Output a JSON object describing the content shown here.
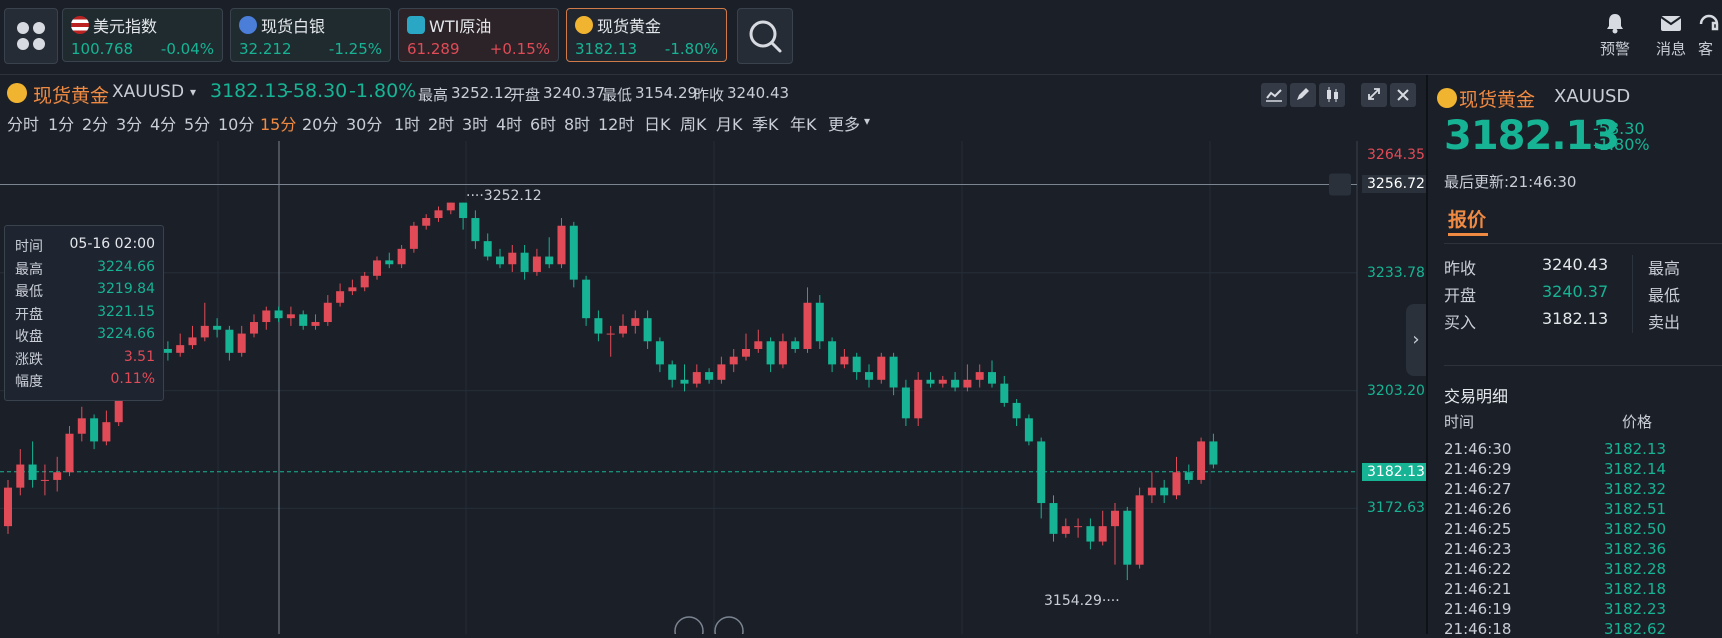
{
  "tickers": [
    {
      "name": "美元指数",
      "price": "100.768",
      "pct": "-0.04%",
      "dir": "down",
      "icon": "us-flag-icon"
    },
    {
      "name": "现货白银",
      "price": "32.212",
      "pct": "-1.25%",
      "dir": "down",
      "icon": "silver-icon"
    },
    {
      "name": "WTI原油",
      "price": "61.289",
      "pct": "+0.15%",
      "dir": "up",
      "icon": "oil-icon"
    },
    {
      "name": "现货黄金",
      "price": "3182.13",
      "pct": "-1.80%",
      "dir": "down",
      "icon": "gold-icon"
    }
  ],
  "tools": [
    {
      "label": "预警",
      "icon": "bell-icon"
    },
    {
      "label": "消息",
      "icon": "mail-icon"
    },
    {
      "label": "客",
      "icon": "headset-icon"
    }
  ],
  "header": {
    "name": "现货黄金",
    "symbol": "XAUUSD",
    "price": "3182.13",
    "change": "-58.30",
    "pct": "-1.80%",
    "high_label": "最高",
    "high": "3252.12",
    "open_label": "开盘",
    "open": "3240.37",
    "low_label": "最低",
    "low": "3154.29",
    "prev_label": "昨收",
    "prev": "3240.43"
  },
  "periods": [
    "分时",
    "1分",
    "2分",
    "3分",
    "4分",
    "5分",
    "10分",
    "15分",
    "20分",
    "30分",
    "1时",
    "2时",
    "3时",
    "4时",
    "6时",
    "8时",
    "12时",
    "日K",
    "周K",
    "月K",
    "季K",
    "年K",
    "更多"
  ],
  "selected_period": "15分",
  "tooltip": {
    "rows": [
      {
        "k": "时间",
        "v": "05-16 02:00"
      },
      {
        "k": "最高",
        "v": "3224.66"
      },
      {
        "k": "最低",
        "v": "3219.84"
      },
      {
        "k": "开盘",
        "v": "3221.15"
      },
      {
        "k": "收盘",
        "v": "3224.66"
      },
      {
        "k": "涨跌",
        "v": "3.51"
      },
      {
        "k": "幅度",
        "v": "0.11%"
      }
    ]
  },
  "axis": {
    "labels": [
      "3264.35",
      "3256.72",
      "3233.78",
      "3203.20",
      "3182.13",
      "3172.63"
    ],
    "high_mark": "3252.12",
    "low_mark": "3154.29"
  },
  "chart_data": {
    "type": "candlestick",
    "ylim": [
      3140,
      3268
    ],
    "candles": [
      [
        3168,
        3178,
        3166,
        3180
      ],
      [
        3178,
        3184,
        3176,
        3188
      ],
      [
        3184,
        3180,
        3178,
        3190
      ],
      [
        3180,
        3180,
        3176,
        3184
      ],
      [
        3180,
        3182,
        3177,
        3186
      ],
      [
        3182,
        3192,
        3181,
        3194
      ],
      [
        3192,
        3196,
        3190,
        3199
      ],
      [
        3196,
        3190,
        3188,
        3197
      ],
      [
        3190,
        3195,
        3189,
        3198
      ],
      [
        3195,
        3205,
        3194,
        3206
      ],
      [
        3205,
        3212,
        3204,
        3214
      ],
      [
        3212,
        3210,
        3208,
        3216
      ],
      [
        3210,
        3214,
        3209,
        3216
      ],
      [
        3214,
        3213,
        3211,
        3216
      ],
      [
        3213,
        3215,
        3212,
        3218
      ],
      [
        3215,
        3217,
        3214,
        3220
      ],
      [
        3217,
        3220,
        3216,
        3226
      ],
      [
        3220,
        3219,
        3217,
        3222
      ],
      [
        3219,
        3213,
        3211,
        3220
      ],
      [
        3213,
        3218,
        3212,
        3220
      ],
      [
        3218,
        3221,
        3217,
        3223
      ],
      [
        3221,
        3224,
        3219,
        3225
      ],
      [
        3224,
        3222,
        3221,
        3225
      ],
      [
        3222,
        3223,
        3220,
        3225
      ],
      [
        3223,
        3220,
        3219,
        3224
      ],
      [
        3220,
        3221,
        3219,
        3223
      ],
      [
        3221,
        3226,
        3220,
        3228
      ],
      [
        3226,
        3229,
        3225,
        3231
      ],
      [
        3229,
        3230,
        3228,
        3232
      ],
      [
        3230,
        3233,
        3229,
        3234
      ],
      [
        3233,
        3237,
        3232,
        3238
      ],
      [
        3237,
        3236,
        3235,
        3239
      ],
      [
        3236,
        3240,
        3235,
        3241
      ],
      [
        3240,
        3246,
        3239,
        3247
      ],
      [
        3246,
        3248,
        3245,
        3249
      ],
      [
        3248,
        3250,
        3247,
        3251
      ],
      [
        3250,
        3252,
        3249,
        3252
      ],
      [
        3252,
        3248,
        3245,
        3252
      ],
      [
        3248,
        3242,
        3240,
        3250
      ],
      [
        3242,
        3238,
        3237,
        3244
      ],
      [
        3238,
        3236,
        3235,
        3240
      ],
      [
        3236,
        3239,
        3234,
        3241
      ],
      [
        3239,
        3234,
        3232,
        3241
      ],
      [
        3234,
        3238,
        3233,
        3240
      ],
      [
        3238,
        3236,
        3235,
        3243
      ],
      [
        3236,
        3246,
        3235,
        3248
      ],
      [
        3246,
        3232,
        3230,
        3247
      ],
      [
        3232,
        3222,
        3220,
        3233
      ],
      [
        3222,
        3218,
        3216,
        3224
      ],
      [
        3218,
        3218,
        3212,
        3220
      ],
      [
        3218,
        3220,
        3217,
        3223
      ],
      [
        3220,
        3222,
        3218,
        3224
      ],
      [
        3222,
        3216,
        3214,
        3224
      ],
      [
        3216,
        3210,
        3208,
        3217
      ],
      [
        3210,
        3206,
        3204,
        3211
      ],
      [
        3206,
        3205,
        3203,
        3210
      ],
      [
        3205,
        3208,
        3204,
        3210
      ],
      [
        3208,
        3206,
        3205,
        3209
      ],
      [
        3206,
        3210,
        3205,
        3212
      ],
      [
        3210,
        3212,
        3208,
        3214
      ],
      [
        3212,
        3214,
        3211,
        3218
      ],
      [
        3214,
        3216,
        3213,
        3219
      ],
      [
        3216,
        3210,
        3208,
        3217
      ],
      [
        3210,
        3216,
        3209,
        3218
      ],
      [
        3216,
        3214,
        3213,
        3217
      ],
      [
        3214,
        3226,
        3213,
        3230
      ],
      [
        3226,
        3216,
        3214,
        3228
      ],
      [
        3216,
        3210,
        3208,
        3217
      ],
      [
        3210,
        3212,
        3209,
        3214
      ],
      [
        3212,
        3208,
        3206,
        3213
      ],
      [
        3208,
        3206,
        3204,
        3210
      ],
      [
        3206,
        3212,
        3205,
        3213
      ],
      [
        3212,
        3204,
        3202,
        3213
      ],
      [
        3204,
        3196,
        3194,
        3206
      ],
      [
        3196,
        3206,
        3194,
        3208
      ],
      [
        3206,
        3205,
        3204,
        3208
      ],
      [
        3205,
        3206,
        3204,
        3207
      ],
      [
        3206,
        3204,
        3203,
        3208
      ],
      [
        3204,
        3206,
        3203,
        3210
      ],
      [
        3206,
        3208,
        3204,
        3210
      ],
      [
        3208,
        3205,
        3204,
        3211
      ],
      [
        3205,
        3200,
        3199,
        3207
      ],
      [
        3200,
        3196,
        3194,
        3201
      ],
      [
        3196,
        3190,
        3189,
        3197
      ],
      [
        3190,
        3174,
        3170,
        3191
      ],
      [
        3174,
        3166,
        3164,
        3176
      ],
      [
        3166,
        3168,
        3165,
        3170
      ],
      [
        3168,
        3168,
        3165,
        3170
      ],
      [
        3168,
        3164,
        3162,
        3170
      ],
      [
        3164,
        3168,
        3163,
        3172
      ],
      [
        3168,
        3172,
        3158,
        3174
      ],
      [
        3172,
        3158,
        3154,
        3173
      ],
      [
        3158,
        3176,
        3157,
        3178
      ],
      [
        3176,
        3178,
        3174,
        3182
      ],
      [
        3178,
        3176,
        3174,
        3180
      ],
      [
        3176,
        3182,
        3175,
        3186
      ],
      [
        3182,
        3180,
        3179,
        3184
      ],
      [
        3180,
        3190,
        3179,
        3191
      ],
      [
        3190,
        3184,
        3183,
        3192
      ]
    ]
  },
  "side": {
    "name": "现货黄金",
    "symbol": "XAUUSD",
    "price": "3182.13",
    "change": "-58.30",
    "pct": "-1.80%",
    "updated": "最后更新:21:46:30",
    "tab": "报价",
    "quotes": [
      {
        "k": "昨收",
        "v": "3240.43",
        "cls": "w",
        "k2": "最高"
      },
      {
        "k": "开盘",
        "v": "3240.37",
        "cls": "g",
        "k2": "最低"
      },
      {
        "k": "买入",
        "v": "3182.13",
        "cls": "w",
        "k2": "卖出"
      }
    ],
    "trades_title": "交易明细",
    "col_time": "时间",
    "col_price": "价格",
    "trades": [
      {
        "t": "21:46:30",
        "p": "3182.13"
      },
      {
        "t": "21:46:29",
        "p": "3182.14"
      },
      {
        "t": "21:46:27",
        "p": "3182.32"
      },
      {
        "t": "21:46:26",
        "p": "3182.51"
      },
      {
        "t": "21:46:25",
        "p": "3182.50"
      },
      {
        "t": "21:46:23",
        "p": "3182.36"
      },
      {
        "t": "21:46:22",
        "p": "3182.28"
      },
      {
        "t": "21:46:21",
        "p": "3182.18"
      },
      {
        "t": "21:46:19",
        "p": "3182.23"
      },
      {
        "t": "21:46:18",
        "p": "3182.62"
      }
    ]
  },
  "colors": {
    "up": "#e04b57",
    "down": "#16b394",
    "accent": "#f08a42"
  }
}
